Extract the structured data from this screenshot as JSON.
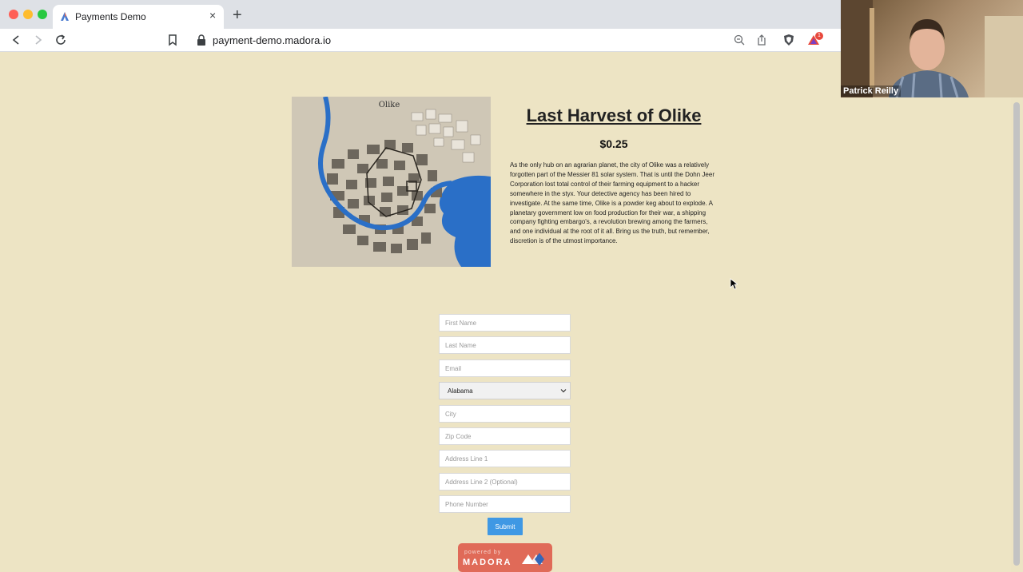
{
  "browser": {
    "tab_title": "Payments Demo",
    "tab_close": "×",
    "new_tab": "+",
    "url": "payment-demo.madora.io",
    "extension_badge": "1"
  },
  "webcam": {
    "participant_name": "Patrick Reilly"
  },
  "product": {
    "map_label": "Olike",
    "title": "Last Harvest of Olike",
    "price": "$0.25",
    "description": "As the only hub on an agrarian planet, the city of Olike was a relatively forgotten part of the Messier 81 solar system. That is until the Dohn Jeer Corporation lost total control of their farming equipment to a hacker somewhere in the styx. Your detective agency has been hired to investigate. At the same time, Olike is a powder keg about to explode. A planetary government low on food production for their war, a shipping company fighting embargo's, a revolution brewing among the farmers, and one individual at the root of it all. Bring us the truth, but remember, discretion is of the utmost importance."
  },
  "form": {
    "first_name_placeholder": "First Name",
    "last_name_placeholder": "Last Name",
    "email_placeholder": "Email",
    "state_value": "Alabama",
    "city_placeholder": "City",
    "zip_placeholder": "Zip Code",
    "address1_placeholder": "Address Line 1",
    "address2_placeholder": "Address Line 2 (Optional)",
    "phone_placeholder": "Phone Number",
    "submit_label": "Submit"
  },
  "footer": {
    "powered_by": "powered by",
    "brand": "MADORA"
  },
  "colors": {
    "page_background": "#ede4c4",
    "submit_blue": "#3f98e4",
    "madora_red": "#e06a58",
    "river_blue": "#2a6fc7"
  }
}
